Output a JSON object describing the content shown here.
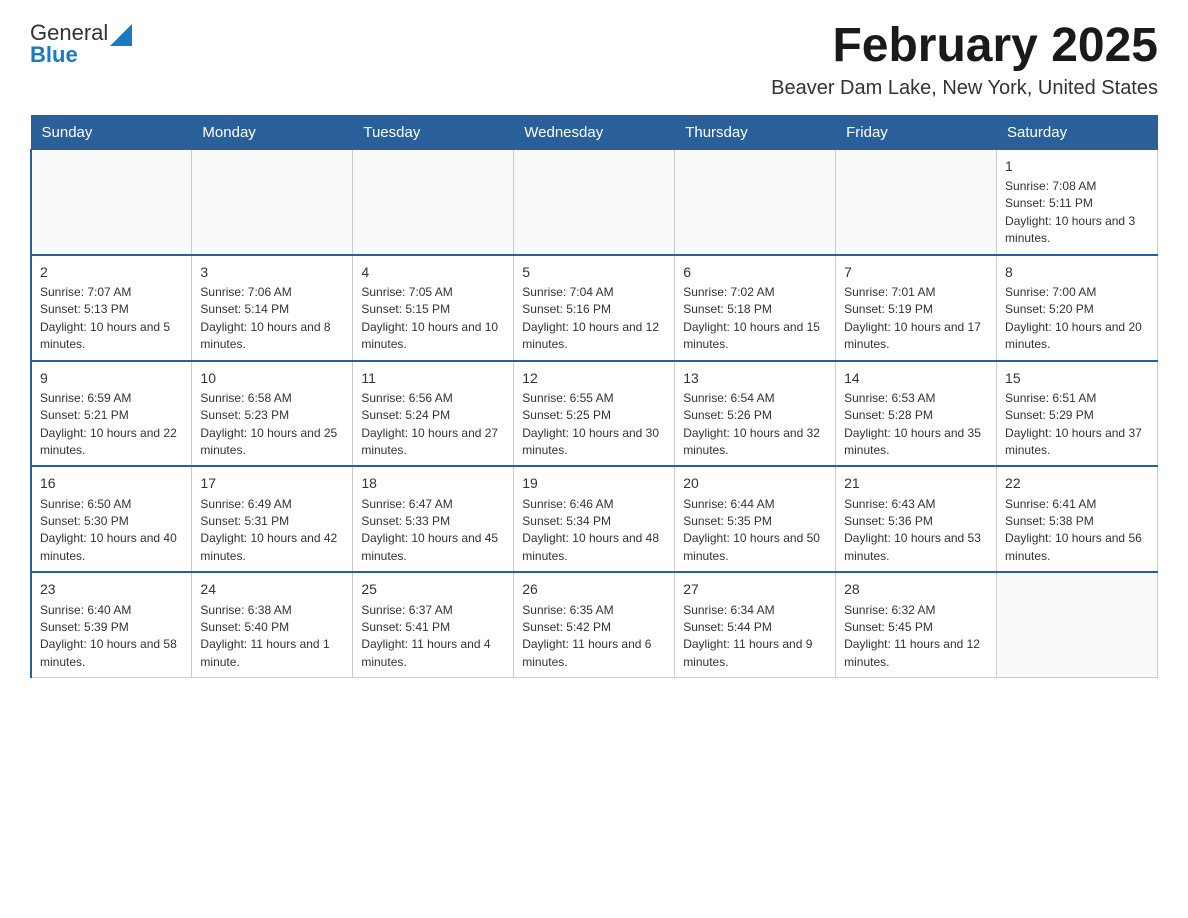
{
  "header": {
    "logo_general": "General",
    "logo_blue": "Blue",
    "month_title": "February 2025",
    "location": "Beaver Dam Lake, New York, United States"
  },
  "weekdays": [
    "Sunday",
    "Monday",
    "Tuesday",
    "Wednesday",
    "Thursday",
    "Friday",
    "Saturday"
  ],
  "weeks": [
    [
      {
        "day": "",
        "info": ""
      },
      {
        "day": "",
        "info": ""
      },
      {
        "day": "",
        "info": ""
      },
      {
        "day": "",
        "info": ""
      },
      {
        "day": "",
        "info": ""
      },
      {
        "day": "",
        "info": ""
      },
      {
        "day": "1",
        "info": "Sunrise: 7:08 AM\nSunset: 5:11 PM\nDaylight: 10 hours and 3 minutes."
      }
    ],
    [
      {
        "day": "2",
        "info": "Sunrise: 7:07 AM\nSunset: 5:13 PM\nDaylight: 10 hours and 5 minutes."
      },
      {
        "day": "3",
        "info": "Sunrise: 7:06 AM\nSunset: 5:14 PM\nDaylight: 10 hours and 8 minutes."
      },
      {
        "day": "4",
        "info": "Sunrise: 7:05 AM\nSunset: 5:15 PM\nDaylight: 10 hours and 10 minutes."
      },
      {
        "day": "5",
        "info": "Sunrise: 7:04 AM\nSunset: 5:16 PM\nDaylight: 10 hours and 12 minutes."
      },
      {
        "day": "6",
        "info": "Sunrise: 7:02 AM\nSunset: 5:18 PM\nDaylight: 10 hours and 15 minutes."
      },
      {
        "day": "7",
        "info": "Sunrise: 7:01 AM\nSunset: 5:19 PM\nDaylight: 10 hours and 17 minutes."
      },
      {
        "day": "8",
        "info": "Sunrise: 7:00 AM\nSunset: 5:20 PM\nDaylight: 10 hours and 20 minutes."
      }
    ],
    [
      {
        "day": "9",
        "info": "Sunrise: 6:59 AM\nSunset: 5:21 PM\nDaylight: 10 hours and 22 minutes."
      },
      {
        "day": "10",
        "info": "Sunrise: 6:58 AM\nSunset: 5:23 PM\nDaylight: 10 hours and 25 minutes."
      },
      {
        "day": "11",
        "info": "Sunrise: 6:56 AM\nSunset: 5:24 PM\nDaylight: 10 hours and 27 minutes."
      },
      {
        "day": "12",
        "info": "Sunrise: 6:55 AM\nSunset: 5:25 PM\nDaylight: 10 hours and 30 minutes."
      },
      {
        "day": "13",
        "info": "Sunrise: 6:54 AM\nSunset: 5:26 PM\nDaylight: 10 hours and 32 minutes."
      },
      {
        "day": "14",
        "info": "Sunrise: 6:53 AM\nSunset: 5:28 PM\nDaylight: 10 hours and 35 minutes."
      },
      {
        "day": "15",
        "info": "Sunrise: 6:51 AM\nSunset: 5:29 PM\nDaylight: 10 hours and 37 minutes."
      }
    ],
    [
      {
        "day": "16",
        "info": "Sunrise: 6:50 AM\nSunset: 5:30 PM\nDaylight: 10 hours and 40 minutes."
      },
      {
        "day": "17",
        "info": "Sunrise: 6:49 AM\nSunset: 5:31 PM\nDaylight: 10 hours and 42 minutes."
      },
      {
        "day": "18",
        "info": "Sunrise: 6:47 AM\nSunset: 5:33 PM\nDaylight: 10 hours and 45 minutes."
      },
      {
        "day": "19",
        "info": "Sunrise: 6:46 AM\nSunset: 5:34 PM\nDaylight: 10 hours and 48 minutes."
      },
      {
        "day": "20",
        "info": "Sunrise: 6:44 AM\nSunset: 5:35 PM\nDaylight: 10 hours and 50 minutes."
      },
      {
        "day": "21",
        "info": "Sunrise: 6:43 AM\nSunset: 5:36 PM\nDaylight: 10 hours and 53 minutes."
      },
      {
        "day": "22",
        "info": "Sunrise: 6:41 AM\nSunset: 5:38 PM\nDaylight: 10 hours and 56 minutes."
      }
    ],
    [
      {
        "day": "23",
        "info": "Sunrise: 6:40 AM\nSunset: 5:39 PM\nDaylight: 10 hours and 58 minutes."
      },
      {
        "day": "24",
        "info": "Sunrise: 6:38 AM\nSunset: 5:40 PM\nDaylight: 11 hours and 1 minute."
      },
      {
        "day": "25",
        "info": "Sunrise: 6:37 AM\nSunset: 5:41 PM\nDaylight: 11 hours and 4 minutes."
      },
      {
        "day": "26",
        "info": "Sunrise: 6:35 AM\nSunset: 5:42 PM\nDaylight: 11 hours and 6 minutes."
      },
      {
        "day": "27",
        "info": "Sunrise: 6:34 AM\nSunset: 5:44 PM\nDaylight: 11 hours and 9 minutes."
      },
      {
        "day": "28",
        "info": "Sunrise: 6:32 AM\nSunset: 5:45 PM\nDaylight: 11 hours and 12 minutes."
      },
      {
        "day": "",
        "info": ""
      }
    ]
  ]
}
